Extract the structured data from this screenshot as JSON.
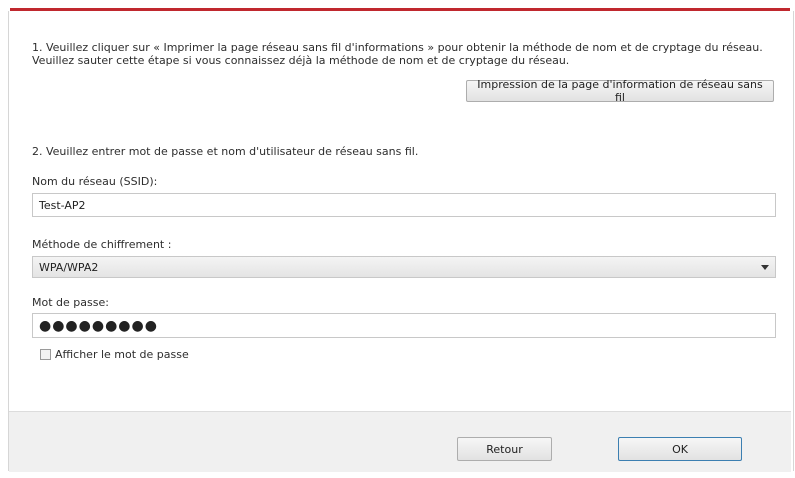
{
  "step1": {
    "text": "1. Veuillez cliquer sur « Imprimer la page réseau sans fil d'informations » pour obtenir la méthode de nom et de cryptage du réseau. Veuillez sauter cette étape si vous connaissez déjà la méthode de nom et de cryptage du réseau.",
    "print_button": "Impression de la page d'information de réseau sans fil"
  },
  "step2": {
    "text": "2. Veuillez entrer mot de passe et nom d'utilisateur de réseau sans fil."
  },
  "ssid": {
    "label": "Nom du réseau (SSID):",
    "value": "Test-AP2"
  },
  "encryption": {
    "label": "Méthode de chiffrement :",
    "selected": "WPA/WPA2"
  },
  "password": {
    "label": "Mot de passe:",
    "masked_value": "●●●●●●●●●"
  },
  "show_password": {
    "label": "Afficher le mot de passe",
    "checked": false
  },
  "footer": {
    "back_label": "Retour",
    "ok_label": "OK"
  },
  "colors": {
    "accent_bar": "#c0282e",
    "ok_border": "#3c7fb1"
  }
}
